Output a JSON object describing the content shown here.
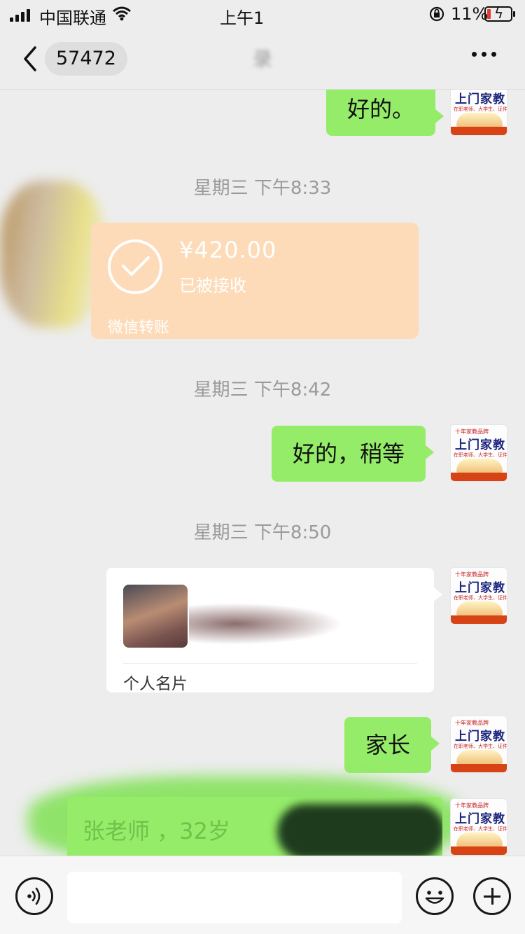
{
  "status_bar": {
    "carrier": "中国联通",
    "time": "上午1",
    "battery_percent": "11%",
    "battery_level": 0.11
  },
  "nav": {
    "unread_count": "57472",
    "title": "录"
  },
  "messages": {
    "msg1": {
      "text": "好的。"
    },
    "ts1": "星期三 下午8:33",
    "transfer": {
      "amount": "¥420.00",
      "status": "已被接收",
      "label": "微信转账"
    },
    "ts2": "星期三 下午8:42",
    "msg2": {
      "text": "好的，稍等"
    },
    "ts3": "星期三 下午8:50",
    "card": {
      "label": "个人名片"
    },
    "msg3": {
      "text": "家长"
    },
    "msg4": {
      "text": "张老师 ，32岁"
    }
  },
  "avatar": {
    "top": "十年家教品牌",
    "title": "上门家教",
    "sub": "在职老师、大学生、证件齐全"
  },
  "colors": {
    "bubble_green": "#95ec69",
    "transfer_orange": "#fddbb9",
    "background": "#ededed"
  }
}
